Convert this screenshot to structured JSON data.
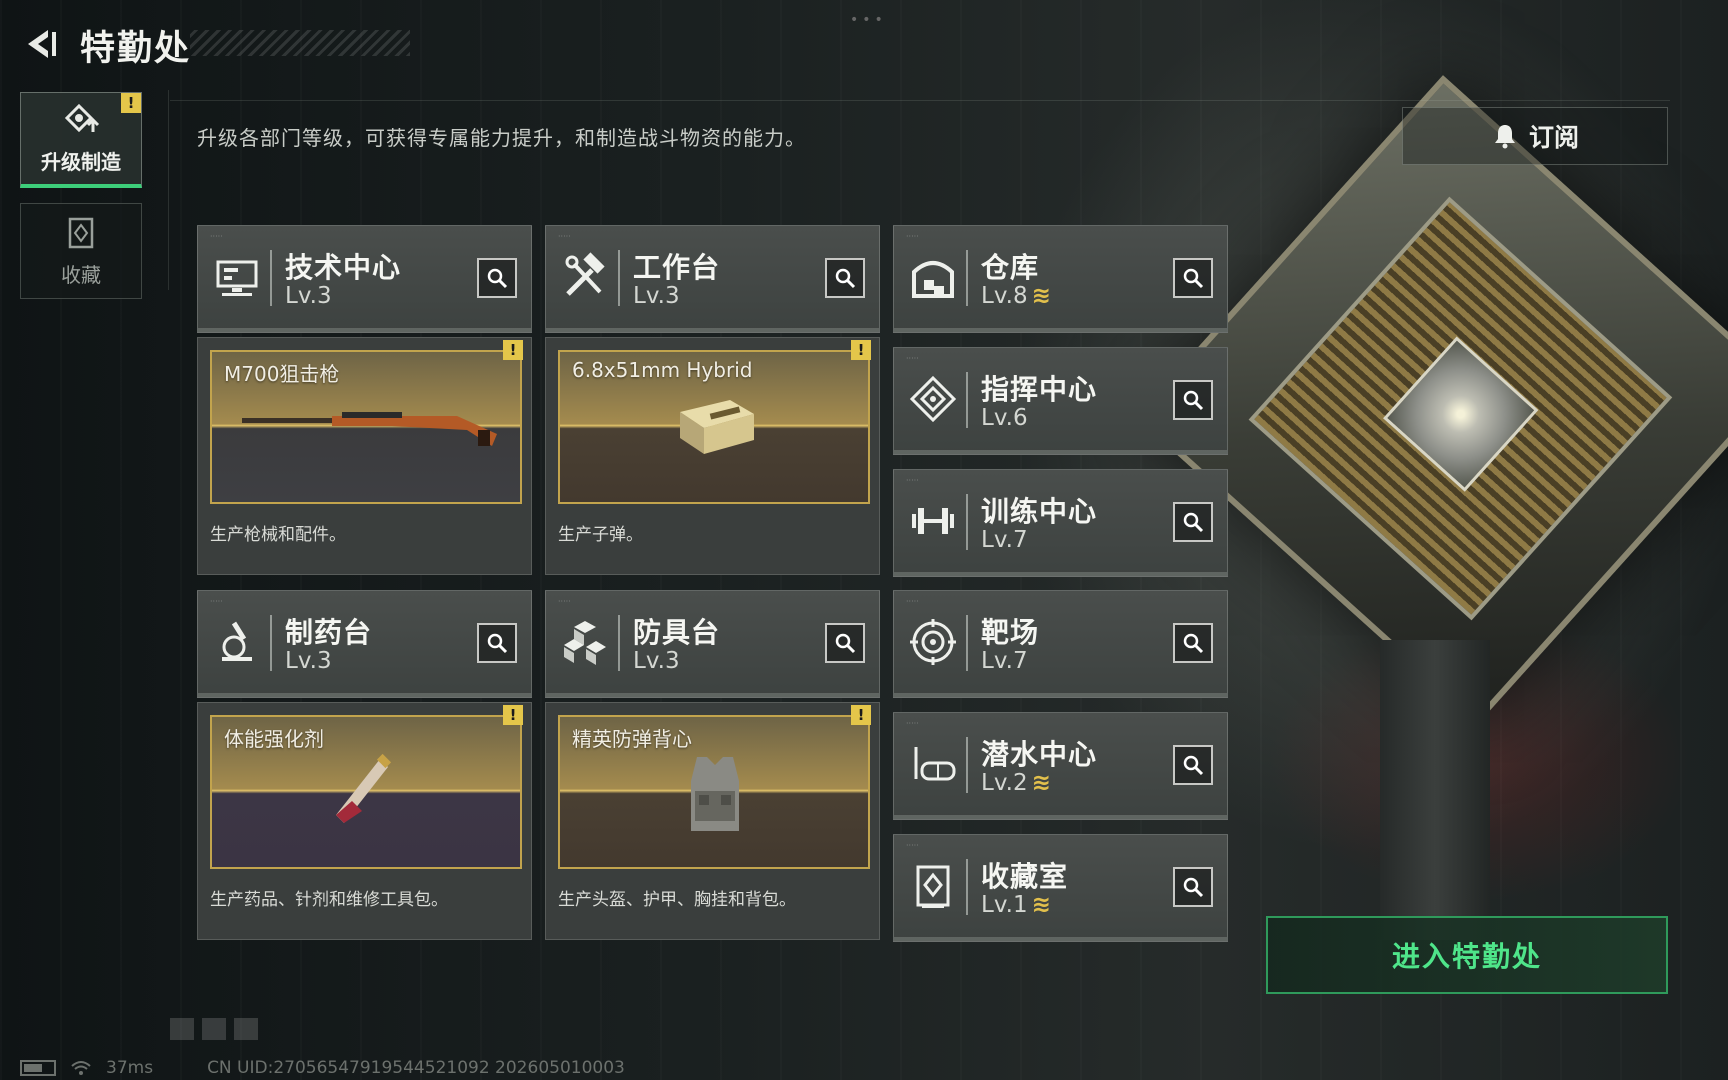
{
  "header": {
    "title": "特勤处",
    "description": "升级各部门等级，可获得专属能力提升，和制造战斗物资的能力。",
    "subscribe_label": "订阅"
  },
  "sidebar": {
    "items": [
      {
        "label": "升级制造",
        "active": true,
        "warning": "!"
      },
      {
        "label": "收藏",
        "active": false
      }
    ]
  },
  "departments": [
    {
      "name": "技术中心",
      "level": "Lv.3",
      "upgrade": false
    },
    {
      "name": "工作台",
      "level": "Lv.3",
      "upgrade": false
    },
    {
      "name": "仓库",
      "level": "Lv.8",
      "upgrade": true
    },
    {
      "name": "指挥中心",
      "level": "Lv.6",
      "upgrade": false
    },
    {
      "name": "训练中心",
      "level": "Lv.7",
      "upgrade": false
    },
    {
      "name": "制药台",
      "level": "Lv.3",
      "upgrade": false
    },
    {
      "name": "防具台",
      "level": "Lv.3",
      "upgrade": false
    },
    {
      "name": "靶场",
      "level": "Lv.7",
      "upgrade": false
    },
    {
      "name": "潜水中心",
      "level": "Lv.2",
      "upgrade": true
    },
    {
      "name": "收藏室",
      "level": "Lv.1",
      "upgrade": true
    }
  ],
  "products": [
    {
      "item": "M700狙击枪",
      "desc": "生产枪械和配件。",
      "warning": "!"
    },
    {
      "item": "6.8x51mm Hybrid",
      "desc": "生产子弹。",
      "warning": "!"
    },
    {
      "item": "体能强化剂",
      "desc": "生产药品、针剂和维修工具包。",
      "warning": "!"
    },
    {
      "item": "精英防弹背心",
      "desc": "生产头盔、护甲、胸挂和背包。",
      "warning": "!"
    }
  ],
  "upgrade_glyph": "≋",
  "enter_button": "进入特勤处",
  "footer": {
    "ping": "37ms",
    "uid": "CN UID:2705654791954452109​2 202605010003"
  },
  "colors": {
    "accent_green": "#4fe58a",
    "warning_yellow": "#e4c64a",
    "frame_gold": "#c2a44d"
  }
}
